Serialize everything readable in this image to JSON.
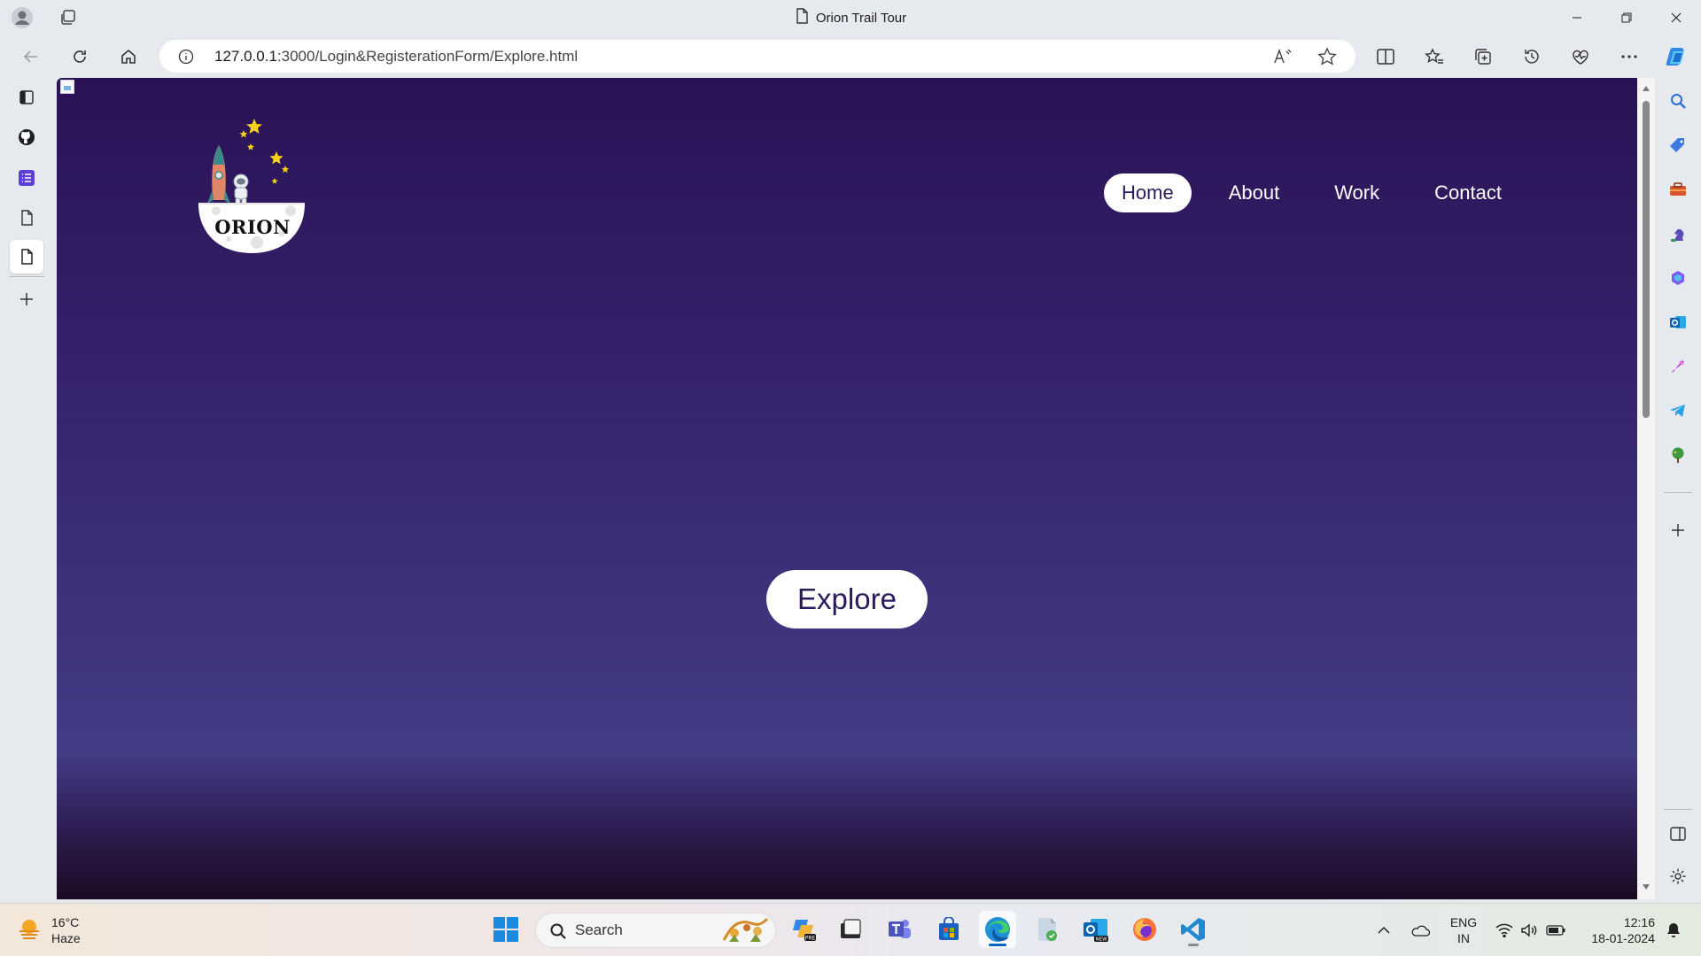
{
  "browser": {
    "window_title": "Orion Trail Tour",
    "url_host": "127.0.0.1",
    "url_rest": ":3000/Login&RegisterationForm/Explore.html"
  },
  "page": {
    "logo_text": "ORION",
    "nav": [
      {
        "label": "Home",
        "active": true
      },
      {
        "label": "About",
        "active": false
      },
      {
        "label": "Work",
        "active": false
      },
      {
        "label": "Contact",
        "active": false
      }
    ],
    "explore_label": "Explore",
    "background_colors": [
      "#2b1256",
      "#433c86",
      "#1c0a22"
    ]
  },
  "taskbar": {
    "weather_temp": "16°C",
    "weather_desc": "Haze",
    "search_label": "Search",
    "lang_line1": "ENG",
    "lang_line2": "IN",
    "time": "12:16",
    "date": "18-01-2024"
  },
  "icons": {
    "left_tabs": [
      "sidebar-panel-icon",
      "github-icon",
      "list-app-icon",
      "document-icon",
      "document-icon"
    ],
    "right_bar": [
      "search-icon",
      "shopping-tag-icon",
      "toolbox-icon",
      "chess-icon",
      "copilot-icon",
      "outlook-icon",
      "designer-icon",
      "telegram-icon",
      "tree-icon",
      "add-icon",
      "split-panel-icon",
      "settings-icon"
    ],
    "taskbar_apps": [
      "copilot-pre-icon",
      "file-manager-icon",
      "teams-icon",
      "store-icon",
      "edge-icon",
      "doc-icon",
      "outlook-new-icon",
      "firefox-icon",
      "vscode-icon"
    ]
  }
}
